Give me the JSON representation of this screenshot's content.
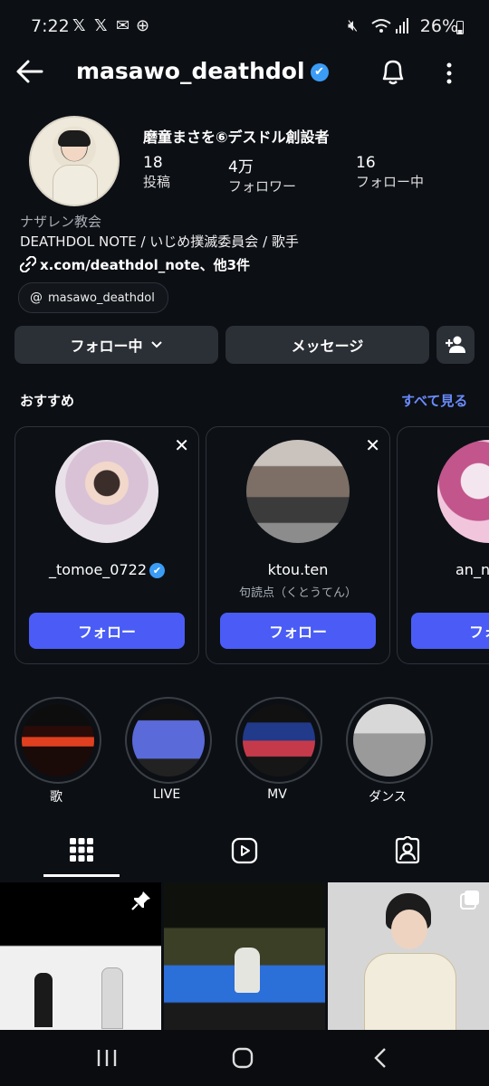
{
  "status_bar": {
    "time": "7:22",
    "battery": "26%",
    "icons": [
      "x-icon",
      "x-icon",
      "mail-icon",
      "globe-icon",
      "mute-icon",
      "wifi-icon",
      "signal-icon",
      "battery-icon"
    ]
  },
  "header": {
    "username": "masawo_deathdol",
    "verified": true
  },
  "profile": {
    "display_name": "磨童まさを⑥デスドル創設者",
    "stats": [
      {
        "value": "18",
        "label": "投稿"
      },
      {
        "value": "4万",
        "label": "フォロワー"
      },
      {
        "value": "16",
        "label": "フォロー中"
      }
    ],
    "category": "ナザレン教会",
    "bio": "DEATHDOL NOTE / いじめ撲滅委員会 / 歌手",
    "link": "x.com/deathdol_note、他3件",
    "threads_handle": "masawo_deathdol"
  },
  "actions": {
    "following_label": "フォロー中",
    "message_label": "メッセージ"
  },
  "suggested": {
    "title": "おすすめ",
    "see_all": "すべて見る",
    "cards": [
      {
        "name": "_tomoe_0722",
        "verified": true,
        "subtitle": "",
        "button": "フォロー"
      },
      {
        "name": "ktou.ten",
        "verified": false,
        "subtitle": "句読点（くとうてん）",
        "button": "フォロー"
      },
      {
        "name": "an_ny",
        "verified": false,
        "subtitle": "",
        "button": "フォ"
      }
    ]
  },
  "highlights": [
    {
      "label": "歌"
    },
    {
      "label": "LIVE"
    },
    {
      "label": "MV"
    },
    {
      "label": "ダンス"
    }
  ],
  "tabs": [
    "grid-icon",
    "reels-icon",
    "tagged-icon"
  ],
  "colors": {
    "background": "#0c0f14",
    "accent": "#4a5cf5",
    "link": "#6b8cff",
    "verified": "#3b9cf5"
  }
}
